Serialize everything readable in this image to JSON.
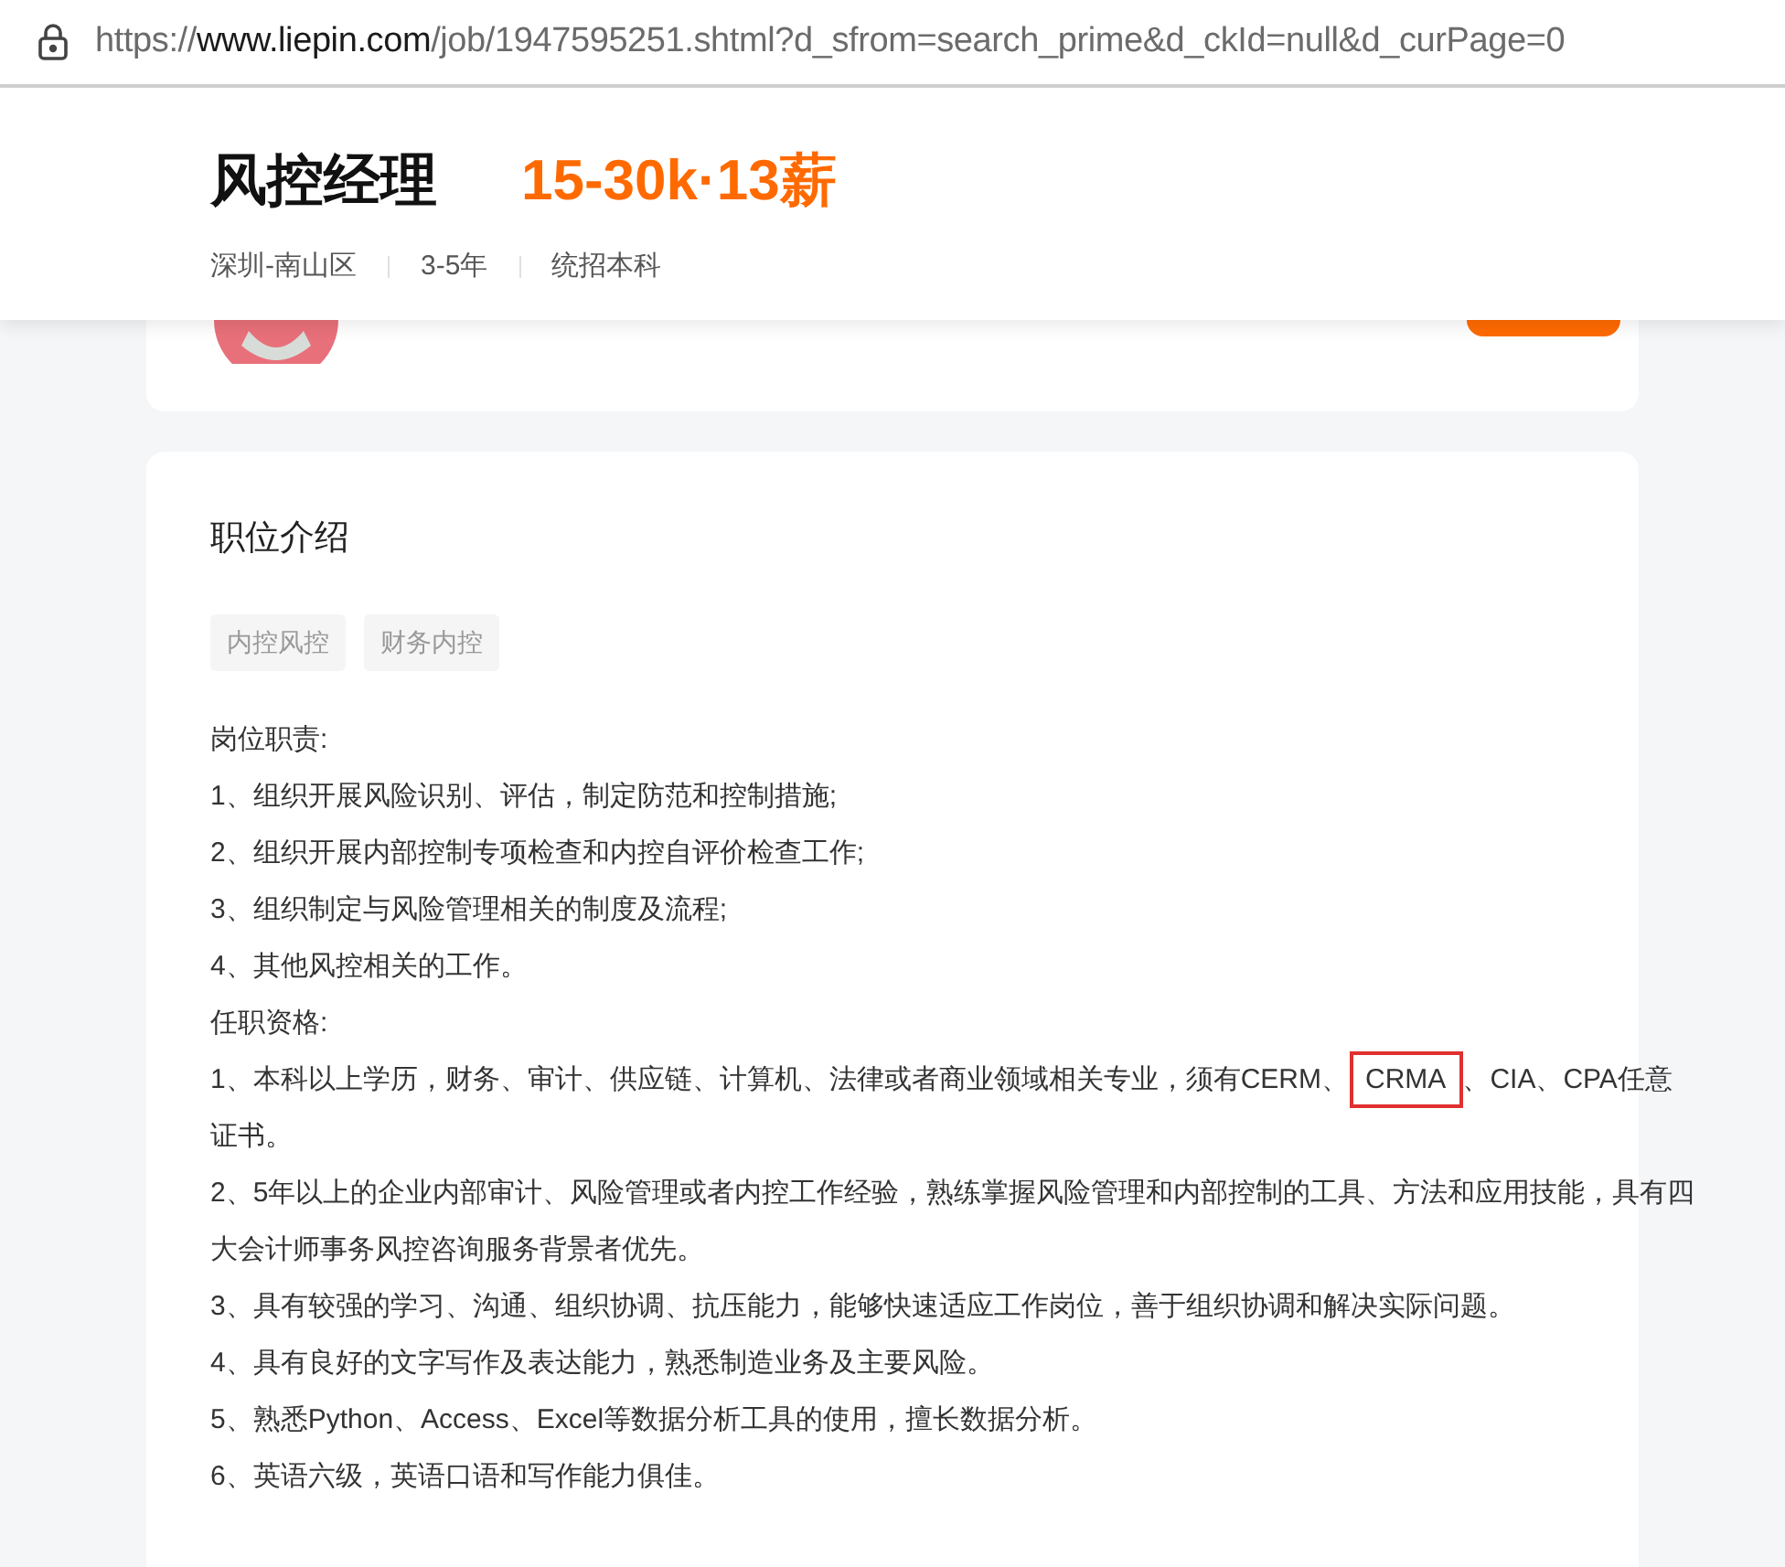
{
  "address_bar": {
    "url_scheme": "https://",
    "url_host": "www.liepin.com",
    "url_path": "/job/1947595251.shtml?d_sfrom=search_prime&d_ckId=null&d_curPage=0"
  },
  "job_header": {
    "title": "风控经理",
    "salary": "15-30k·13薪",
    "tags": [
      "深圳-南山区",
      "3-5年",
      "统招本科"
    ]
  },
  "section": {
    "heading": "职位介绍",
    "labels": [
      "内控风控",
      "财务内控"
    ],
    "lines": [
      {
        "kind": "plain",
        "text": "岗位职责:"
      },
      {
        "kind": "plain",
        "text": "1、组织开展风险识别、评估，制定防范和控制措施;"
      },
      {
        "kind": "plain",
        "text": "2、组织开展内部控制专项检查和内控自评价检查工作;"
      },
      {
        "kind": "plain",
        "text": "3、组织制定与风险管理相关的制度及流程;"
      },
      {
        "kind": "plain",
        "text": "4、其他风控相关的工作。"
      },
      {
        "kind": "plain",
        "text": "任职资格:"
      },
      {
        "kind": "highlight",
        "before": "1、本科以上学历，财务、审计、供应链、计算机、法律或者商业领域相关专业，须有CERM、",
        "highlighted": "CRMA",
        "after": "、CIA、CPA任意证书。"
      },
      {
        "kind": "plain",
        "text": "2、5年以上的企业内部审计、风险管理或者内控工作经验，熟练掌握风险管理和内部控制的工具、方法和应用技能，具有四大会计师事务风控咨询服务背景者优先。"
      },
      {
        "kind": "plain",
        "text": "3、具有较强的学习、沟通、组织协调、抗压能力，能够快速适应工作岗位，善于组织协调和解决实际问题。"
      },
      {
        "kind": "plain",
        "text": "4、具有良好的文字写作及表达能力，熟悉制造业务及主要风险。"
      },
      {
        "kind": "plain",
        "text": "5、熟悉Python、Access、Excel等数据分析工具的使用，擅长数据分析。"
      },
      {
        "kind": "plain",
        "text": "6、英语六级，英语口语和写作能力俱佳。"
      }
    ]
  }
}
